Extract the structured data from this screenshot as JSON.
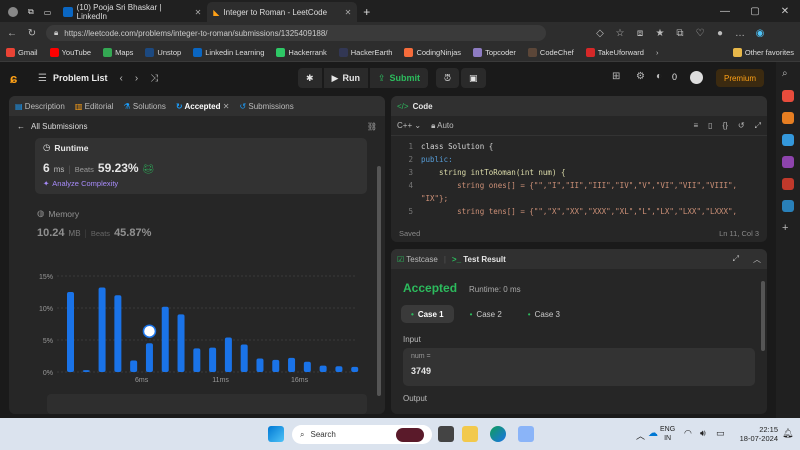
{
  "browser": {
    "tabs": [
      {
        "title": "(10) Pooja Sri Bhaskar | LinkedIn",
        "active": false
      },
      {
        "title": "Integer to Roman - LeetCode",
        "active": true
      }
    ],
    "url": "https://leetcode.com/problems/integer-to-roman/submissions/1325409188/",
    "bookmarks": [
      {
        "label": "Gmail",
        "color": "#ea4335"
      },
      {
        "label": "YouTube",
        "color": "#ff0000"
      },
      {
        "label": "Maps",
        "color": "#34a853"
      },
      {
        "label": "Unstop",
        "color": "#1c4980"
      },
      {
        "label": "Linkedin Learning",
        "color": "#0a66c2"
      },
      {
        "label": "Hackerrank",
        "color": "#2ec866"
      },
      {
        "label": "HackerEarth",
        "color": "#323754"
      },
      {
        "label": "CodingNinjas",
        "color": "#f66c3b"
      },
      {
        "label": "Topcoder",
        "color": "#8e7cc3"
      },
      {
        "label": "CodeChef",
        "color": "#5b4638"
      },
      {
        "label": "TakeUforward",
        "color": "#d62828"
      }
    ],
    "other_favorites": "Other favorites"
  },
  "leetcode": {
    "problem_list": "Problem List",
    "run": "Run",
    "submit": "Submit",
    "streak": "0",
    "premium": "Premium"
  },
  "left": {
    "tabs": [
      "Description",
      "Editorial",
      "Solutions",
      "Accepted",
      "Submissions"
    ],
    "all_submissions": "All Submissions",
    "runtime_label": "Runtime",
    "runtime_value": "6",
    "runtime_unit": "ms",
    "beats_label": "Beats",
    "runtime_beats": "59.23%",
    "analyze": "Analyze Complexity",
    "memory_label": "Memory",
    "memory_value": "10.24",
    "memory_unit": "MB",
    "memory_beats": "45.87%"
  },
  "chart_data": {
    "type": "bar",
    "yticks": [
      "15%",
      "10%",
      "5%",
      "0%"
    ],
    "ylim": [
      0,
      15
    ],
    "xticks": [
      "6ms",
      "11ms",
      "16ms"
    ],
    "values": [
      12.5,
      0.3,
      13.2,
      12.0,
      1.8,
      4.5,
      10.2,
      9.0,
      3.7,
      3.8,
      5.4,
      4.3,
      2.1,
      1.9,
      2.2,
      1.6,
      1.0,
      0.9,
      0.8
    ],
    "highlight_index": 5,
    "highlight_color": "#ffffff",
    "bar_color": "#1a73e8"
  },
  "editor": {
    "title": "Code",
    "language": "C++",
    "mode": "Auto",
    "lines": [
      {
        "n": "1",
        "code": "class Solution {"
      },
      {
        "n": "2",
        "code": "public:"
      },
      {
        "n": "3",
        "code": "    string intToRoman(int num) {"
      },
      {
        "n": "4",
        "code": "        string ones[] = {\"\",\"I\",\"II\",\"III\",\"IV\",\"V\",\"VI\",\"VII\",\"VIII\","
      },
      {
        "n": "",
        "code": "\"IX\"};"
      },
      {
        "n": "5",
        "code": "        string tens[] = {\"\",\"X\",\"XX\",\"XXX\",\"XL\",\"L\",\"LX\",\"LXX\",\"LXXX\","
      }
    ],
    "saved": "Saved",
    "position": "Ln 11, Col 3"
  },
  "test": {
    "testcase_tab": "Testcase",
    "result_tab": "Test Result",
    "status": "Accepted",
    "runtime": "Runtime: 0 ms",
    "cases": [
      "Case 1",
      "Case 2",
      "Case 3"
    ],
    "input_label": "Input",
    "param_name": "num =",
    "param_value": "3749",
    "output_label": "Output"
  },
  "taskbar": {
    "search": "Search",
    "lang1": "ENG",
    "lang2": "IN",
    "time": "22:15",
    "date": "18-07-2024"
  }
}
